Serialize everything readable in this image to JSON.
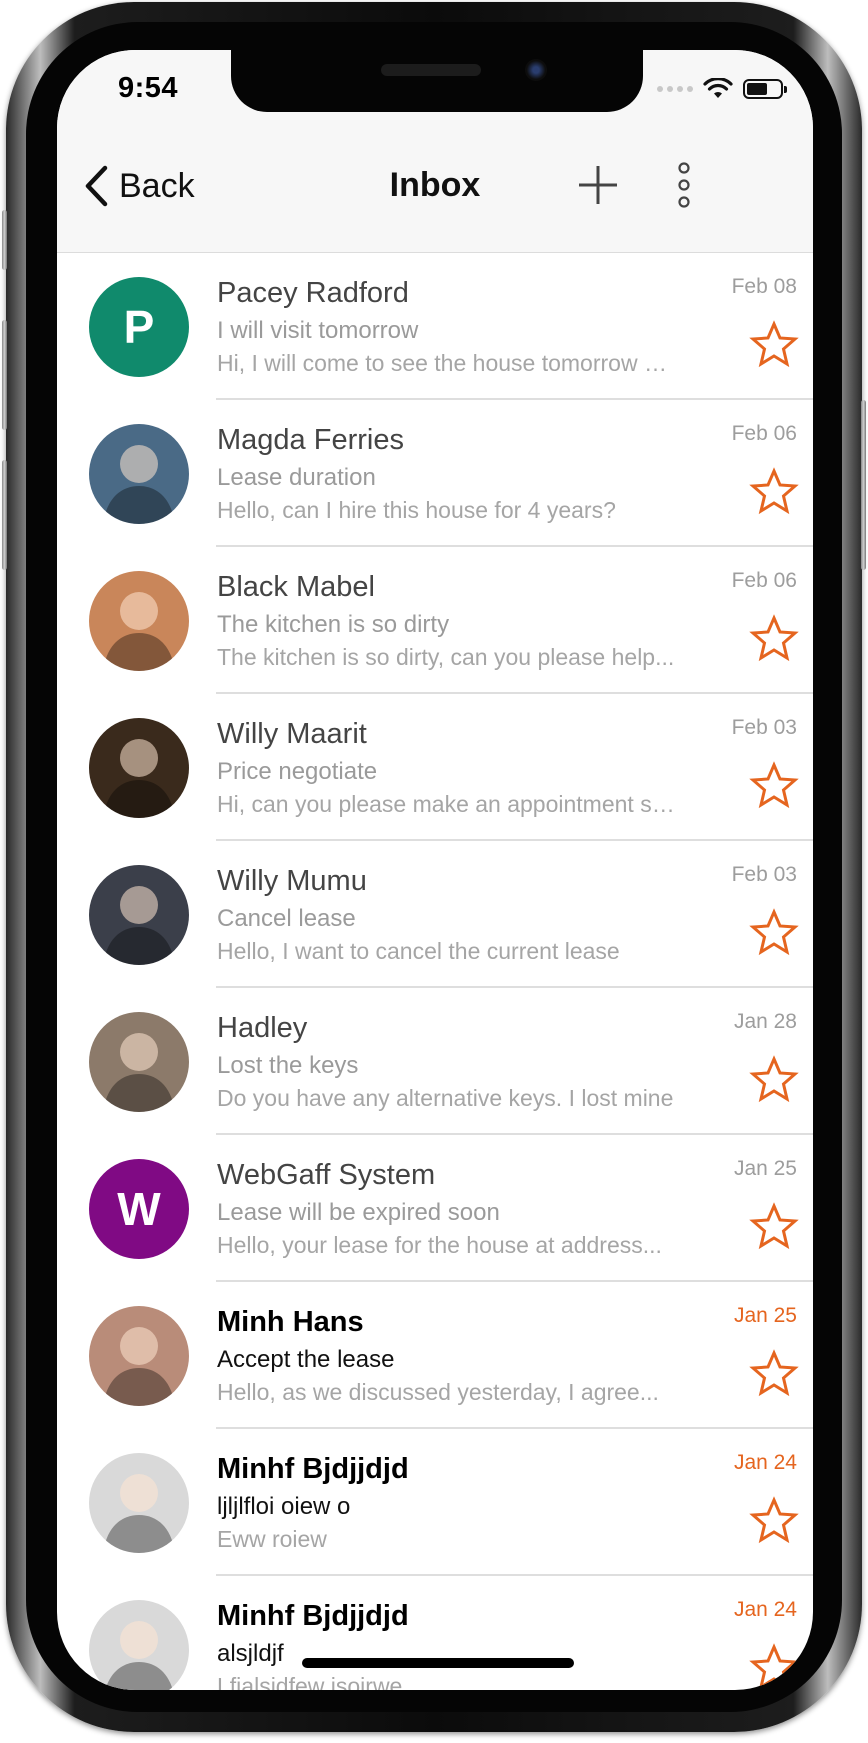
{
  "status_bar": {
    "time": "9:54",
    "wifi_icon": "wifi-icon",
    "battery_icon": "battery-icon"
  },
  "nav": {
    "back_label": "Back",
    "title": "Inbox",
    "add_icon": "plus-icon",
    "more_icon": "vertical-ellipsis-icon"
  },
  "colors": {
    "accent": "#e5651f",
    "unread_date": "#e5651f",
    "read_text": "#9a9a9a"
  },
  "messages": [
    {
      "sender": "Pacey Radford",
      "subject": "I will visit tomorrow",
      "preview": "Hi, I will come to see the house tomorrow m...",
      "date": "Feb 08",
      "avatar_letter": "P",
      "avatar_color": "#108a6c",
      "avatar_type": "letter",
      "unread": false
    },
    {
      "sender": "Magda Ferries",
      "subject": "Lease duration",
      "preview": "Hello, can I hire this house for 4 years?",
      "date": "Feb 06",
      "avatar_type": "photo",
      "avatar_color": "#4a6a86",
      "unread": false
    },
    {
      "sender": "Black Mabel",
      "subject": "The kitchen is so dirty",
      "preview": "The kitchen is so dirty, can you please help...",
      "date": "Feb 06",
      "avatar_type": "photo",
      "avatar_color": "#c9865a",
      "unread": false
    },
    {
      "sender": "Willy Maarit",
      "subject": "Price negotiate",
      "preview": "Hi, can you please make an appointment so...",
      "date": "Feb 03",
      "avatar_type": "photo",
      "avatar_color": "#3a2a1c",
      "unread": false
    },
    {
      "sender": "Willy Mumu",
      "subject": "Cancel lease",
      "preview": "Hello, I want to cancel the current lease",
      "date": "Feb 03",
      "avatar_type": "photo",
      "avatar_color": "#3b3f4a",
      "unread": false
    },
    {
      "sender": "Hadley",
      "subject": "Lost the keys",
      "preview": "Do you have any alternative keys. I lost mine",
      "date": "Jan 28",
      "avatar_type": "photo",
      "avatar_color": "#8c7a6a",
      "unread": false
    },
    {
      "sender": "WebGaff System",
      "subject": "Lease will be expired soon",
      "preview": "Hello, your lease for the house at address...",
      "date": "Jan 25",
      "avatar_letter": "W",
      "avatar_color": "#800a84",
      "avatar_type": "letter",
      "unread": false
    },
    {
      "sender": "Minh Hans",
      "subject": "Accept the lease",
      "preview": "Hello, as we discussed yesterday, I agree...",
      "date": "Jan 25",
      "avatar_type": "photo",
      "avatar_color": "#b98c79",
      "unread": true
    },
    {
      "sender": "Minhf Bjdjjdjd",
      "subject": "ljljlfloi oiew o",
      "preview": "Eww roiew",
      "date": "Jan 24",
      "avatar_type": "photo",
      "avatar_color": "#d9d9d9",
      "unread": true
    },
    {
      "sender": "Minhf Bjdjjdjd",
      "subject": "alsjldjf",
      "preview": "Lfjalsjdfew jsoirwe",
      "date": "Jan 24",
      "avatar_type": "photo",
      "avatar_color": "#d9d9d9",
      "unread": true
    }
  ]
}
